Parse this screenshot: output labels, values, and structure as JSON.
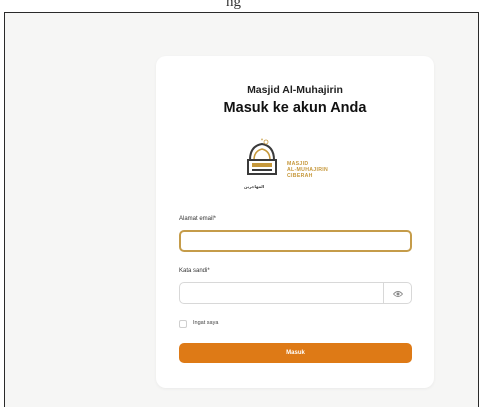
{
  "header_fragment": "ng",
  "site_name": "Masjid Al-Muhajirin",
  "heading": "Masuk ke akun Anda",
  "logo": {
    "name_lines": [
      "MASJID",
      "AL-MUHAJIRIN",
      "CIBERAH"
    ],
    "arabic_sub": "المهاجرين"
  },
  "form": {
    "email_label": "Alamat email*",
    "email_value": "",
    "password_label": "Kata sandi*",
    "password_value": "",
    "remember_label": "Ingat saya",
    "submit_label": "Masuk"
  },
  "colors": {
    "accent": "#de7a16",
    "focus_border": "#c59c4a",
    "logo_gold": "#c6983b"
  }
}
